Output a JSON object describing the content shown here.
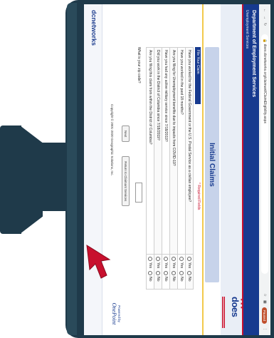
{
  "browser": {
    "nav_icons": [
      "back-icon",
      "forward-icon",
      "reload-icon"
    ],
    "url": "does.dcnetworks.org/claimant/ClaimEligibility.aspx",
    "paused_label": "Paused"
  },
  "header": {
    "department": "Department of Employment Services",
    "subtitle": "Unemployment Services",
    "logo_text": "does"
  },
  "page": {
    "title": "Initial Claims",
    "section_tab": "File Your Claim",
    "required_note": "* Required Fields"
  },
  "questions": [
    {
      "text": "Have you worked for the Federal Government or the U.S. Postal Service as a civilian employee?",
      "options": [
        "Yes",
        "No"
      ]
    },
    {
      "text": "Have you worked in the past 18 months?",
      "options": [
        "Yes",
        "No"
      ]
    },
    {
      "text": "Are you filing for Unemployment benefits due to impacts from COVID-19?",
      "options": [
        "Yes",
        "No"
      ]
    },
    {
      "text": "Have you had any active military service since 7/18/2019?",
      "options": [
        "Yes",
        "No"
      ]
    },
    {
      "text": "Did you work in the District of Columbia since 7/18/2019?",
      "options": [
        "Yes",
        "No"
      ]
    },
    {
      "text": "Are you filing this claim from within the District of Columbia?",
      "options": [
        "Yes",
        "No"
      ]
    }
  ],
  "zip": {
    "label": "What is your zip code?",
    "value": ""
  },
  "buttons": {
    "next": "Next",
    "return": "Return to Claimant Services"
  },
  "footer": {
    "powered_by": "Powered by",
    "brand": "OnePoint",
    "copyright": "Copyright © 2001-2020 Geographic Solutions, Inc.",
    "footer_logo": "dcnetworks"
  }
}
